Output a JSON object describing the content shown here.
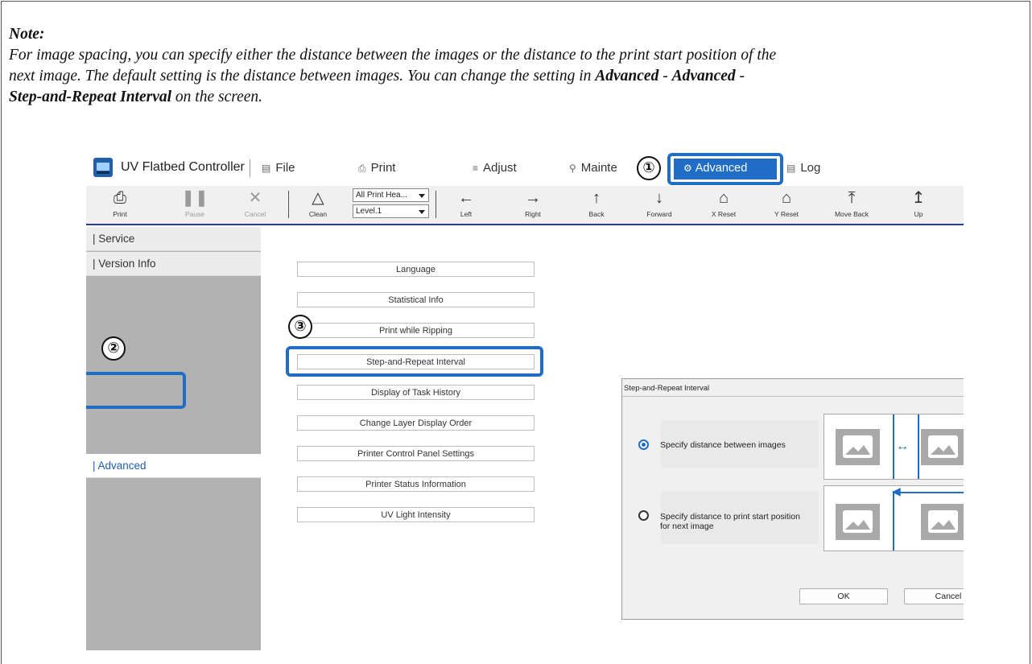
{
  "note": {
    "title": "Note:",
    "line1": "For image spacing, you can specify either the distance between the images or the distance to the print start position of the",
    "line2": "next image. The default setting is the distance between images. You can change the setting in ",
    "bold1": "Advanced",
    "sep1": " - ",
    "bold2": "Advanced",
    "sep2": " -",
    "bold3": "Step-and-Repeat Interval",
    "line3_rest": " on the screen."
  },
  "app": {
    "title": "UV Flatbed Controller",
    "menu": [
      {
        "label": "File",
        "icon": "file-icon"
      },
      {
        "label": "Print",
        "icon": "printer-icon"
      },
      {
        "label": "Adjust",
        "icon": "adjust-icon"
      },
      {
        "label": "Mainte",
        "icon": "wrench-icon"
      },
      {
        "label": "Advanced",
        "icon": "advanced-settings-icon"
      },
      {
        "label": "Log",
        "icon": "log-icon"
      }
    ]
  },
  "toolbar": {
    "print": "Print",
    "pause": "Pause",
    "cancel": "Cancel",
    "clean": "Clean",
    "head_select": "All Print Hea...",
    "level_select": "Level.1",
    "left": "Left",
    "right": "Right",
    "back": "Back",
    "forward": "Forward",
    "x_reset": "X Reset",
    "y_reset": "Y Reset",
    "move_back": "Move Back",
    "up": "Up"
  },
  "sidebar": {
    "items": [
      "| Service",
      "| Version Info",
      "| Advanced"
    ],
    "active": "| Advanced"
  },
  "advanced_list": [
    "Language",
    "Statistical Info",
    "Print while Ripping",
    "Step-and-Repeat Interval",
    "Display of Task History",
    "Change Layer Display Order",
    "Printer Control Panel Settings",
    "Printer Status Information",
    "UV Light Intensity"
  ],
  "dialog": {
    "title": "Step-and-Repeat Interval",
    "option1": "Specify distance between images",
    "option2_line1": "Specify distance to print start position",
    "option2_line2": "for next image",
    "selected": "Specify distance between images",
    "ok": "OK",
    "cancel": "Cancel"
  },
  "callouts": [
    "①",
    "②",
    "③"
  ],
  "colors": {
    "accent": "#1f6dc5",
    "sidebar_bg": "#b2b2b2",
    "toolbar_bg": "#f0f0f0",
    "toolbar_border": "#2a3f8c"
  }
}
